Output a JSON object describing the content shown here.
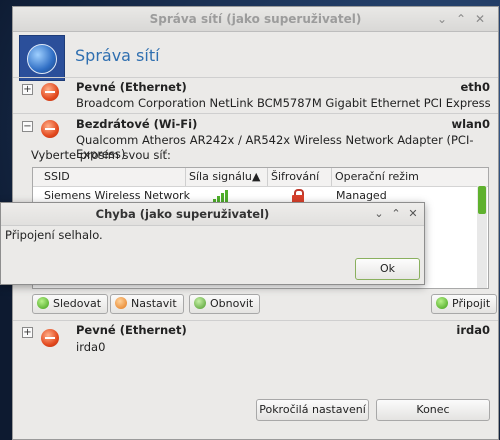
{
  "window": {
    "title": "Správa sítí (jako superuživatel)",
    "app_title": "Správa sítí"
  },
  "devices": [
    {
      "name": "Pevné (Ethernet)",
      "description": "Broadcom Corporation NetLink BCM5787M Gigabit Ethernet PCI Express",
      "interface": "eth0",
      "expander": "+"
    },
    {
      "name": "Bezdrátové (Wi-Fi)",
      "description": "Qualcomm Atheros AR242x / AR542x Wireless Network Adapter (PCI-Express)",
      "interface": "wlan0",
      "expander": "−"
    },
    {
      "name": "Pevné (Ethernet)",
      "description": "irda0",
      "interface": "irda0",
      "expander": "+"
    }
  ],
  "wifi": {
    "select_label": "Vyberte prosím svou síť:",
    "columns": [
      "SSID",
      "Síla signálu",
      "Šifrování",
      "Operační režim"
    ],
    "sort_indicator": "▲",
    "networks": [
      {
        "ssid": "Siemens Wireless Network",
        "signal": 0.75,
        "encrypted": true,
        "mode": "Managed"
      }
    ],
    "buttons": {
      "track": "Sledovat",
      "configure": "Nastavit",
      "refresh": "Obnovit",
      "connect": "Připojit"
    }
  },
  "footer": {
    "advanced": "Pokročilá nastavení",
    "close": "Konec"
  },
  "dialog": {
    "title": "Chyba (jako superuživatel)",
    "message": "Připojení selhalo.",
    "ok": "Ok"
  },
  "colors": {
    "accent": "#2f6fb0",
    "device_icon": "#e34a1f",
    "signal": "#4fae2a",
    "lock": "#d9402b"
  }
}
